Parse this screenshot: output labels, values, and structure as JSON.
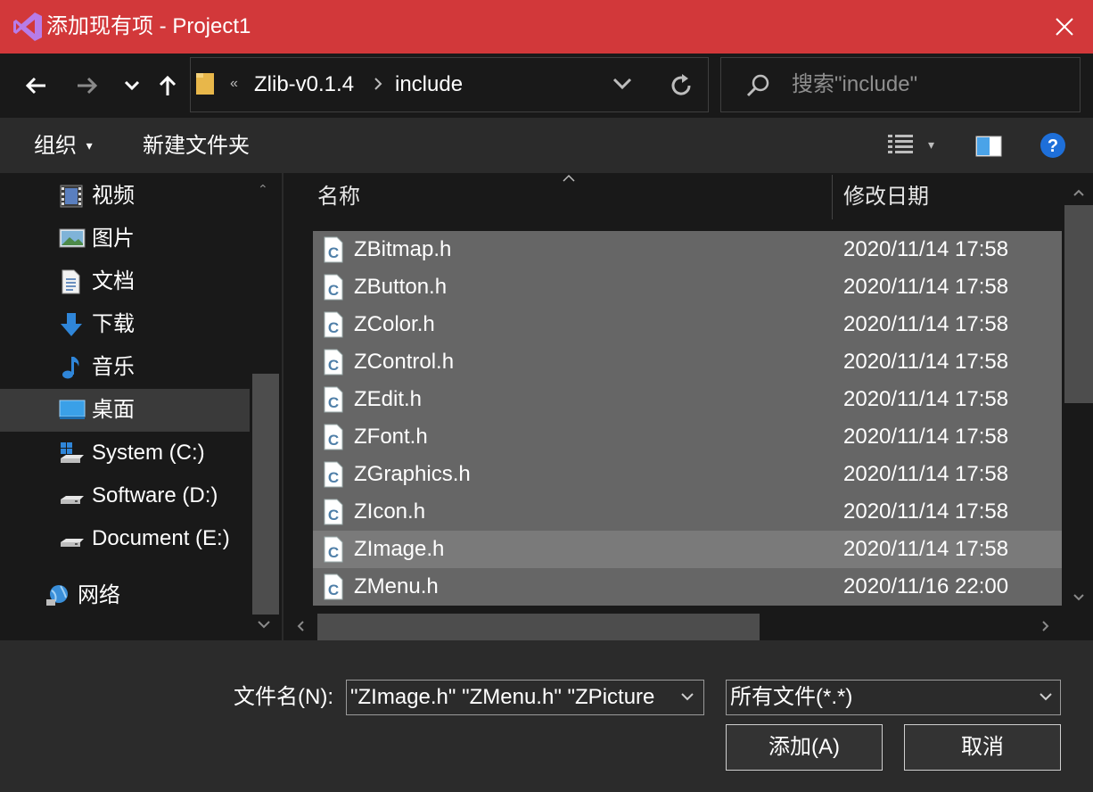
{
  "window": {
    "title": "添加现有项 - Project1"
  },
  "address": {
    "overflow": "«",
    "segments": [
      "Zlib-v0.1.4",
      "include"
    ]
  },
  "search": {
    "placeholder": "搜索\"include\""
  },
  "toolbar": {
    "organize_label": "组织",
    "new_folder_label": "新建文件夹"
  },
  "sidebar": {
    "items": [
      {
        "label": "视频",
        "icon": "video-icon"
      },
      {
        "label": "图片",
        "icon": "pictures-icon"
      },
      {
        "label": "文档",
        "icon": "documents-icon"
      },
      {
        "label": "下载",
        "icon": "download-icon"
      },
      {
        "label": "音乐",
        "icon": "music-icon"
      },
      {
        "label": "桌面",
        "icon": "desktop-icon",
        "selected": true
      },
      {
        "label": "System (C:)",
        "icon": "system-drive-icon"
      },
      {
        "label": "Software (D:)",
        "icon": "drive-icon"
      },
      {
        "label": "Document (E:)",
        "icon": "drive-icon"
      },
      {
        "label": "网络",
        "icon": "network-icon"
      }
    ]
  },
  "file_list": {
    "columns": [
      "名称",
      "修改日期"
    ],
    "rows": [
      {
        "name": "ZBitmap.h",
        "date": "2020/11/14 17:58"
      },
      {
        "name": "ZButton.h",
        "date": "2020/11/14 17:58"
      },
      {
        "name": "ZColor.h",
        "date": "2020/11/14 17:58"
      },
      {
        "name": "ZControl.h",
        "date": "2020/11/14 17:58"
      },
      {
        "name": "ZEdit.h",
        "date": "2020/11/14 17:58"
      },
      {
        "name": "ZFont.h",
        "date": "2020/11/14 17:58"
      },
      {
        "name": "ZGraphics.h",
        "date": "2020/11/14 17:58"
      },
      {
        "name": "ZIcon.h",
        "date": "2020/11/14 17:58"
      },
      {
        "name": "ZImage.h",
        "date": "2020/11/14 17:58",
        "hovered": true
      },
      {
        "name": "ZMenu.h",
        "date": "2020/11/16 22:00"
      }
    ]
  },
  "footer": {
    "filename_label": "文件名(N):",
    "filename_value": "\"ZImage.h\" \"ZMenu.h\" \"ZPicture",
    "filter_value": "所有文件(*.*)",
    "add_button": "添加(A)",
    "cancel_button": "取消"
  },
  "colors": {
    "titlebar": "#d2383a",
    "selection": "#666666",
    "hover": "#7a7a7a",
    "help": "#1e6fd9"
  }
}
